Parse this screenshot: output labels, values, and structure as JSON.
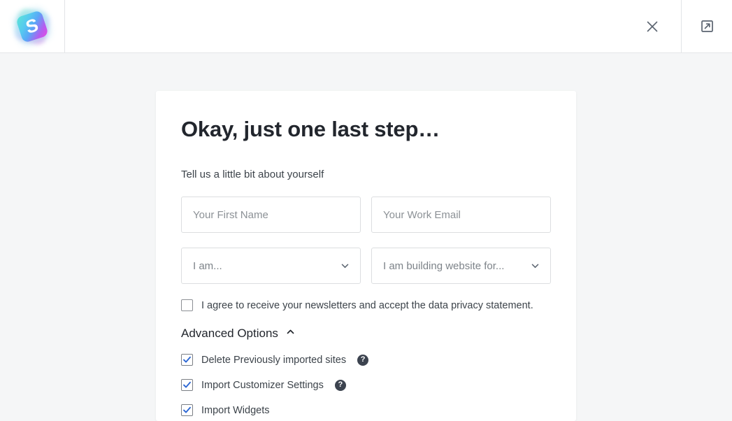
{
  "topbar": {
    "logo": {
      "name": "starter-templates-logo",
      "letter": "S"
    },
    "close_icon": "close-icon",
    "external_link_icon": "external-link-icon"
  },
  "card": {
    "title": "Okay, just one last step…",
    "subtitle": "Tell us a little bit about yourself",
    "fields": {
      "first_name_placeholder": "Your First Name",
      "email_placeholder": "Your Work Email",
      "role_select_value": "I am...",
      "purpose_select_value": "I am building website for..."
    },
    "consent": {
      "label": "I agree to receive your newsletters and accept the data privacy statement.",
      "checked": false
    },
    "advanced": {
      "label": "Advanced Options",
      "expanded": true,
      "options": [
        {
          "label": "Delete Previously imported sites",
          "checked": true,
          "help": "?"
        },
        {
          "label": "Import Customizer Settings",
          "checked": true,
          "help": "?"
        },
        {
          "label": "Import Widgets",
          "checked": true,
          "help": ""
        }
      ]
    }
  },
  "colors": {
    "page_background": "#f5f6f7",
    "card_background": "#ffffff",
    "title": "#22262d",
    "checkbox_accent": "#2d68d4",
    "help_icon_background": "#3c434f"
  }
}
